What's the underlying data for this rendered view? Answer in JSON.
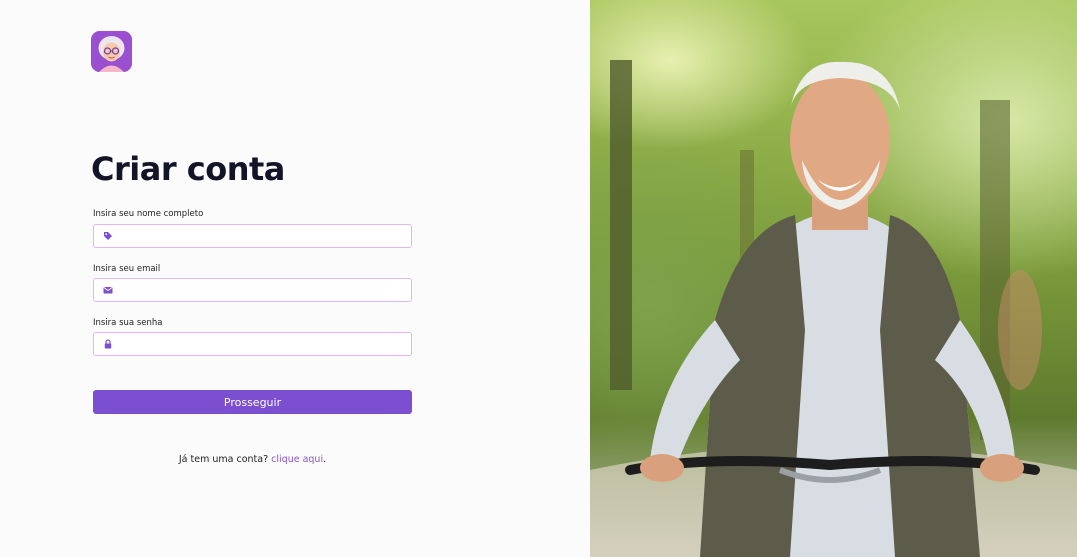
{
  "form": {
    "title": "Criar conta",
    "name_label": "Insira seu nome completo",
    "name_value": "",
    "email_label": "Insira seu email",
    "email_value": "",
    "password_label": "Insira sua senha",
    "password_value": "",
    "submit_label": "Prosseguir",
    "login_prompt": "Já tem uma conta?",
    "login_link": "clique aqui",
    "login_suffix": "."
  },
  "icons": {
    "name_field": "tag-icon",
    "email_field": "envelope-icon",
    "password_field": "lock-icon"
  },
  "colors": {
    "accent": "#7b4fcf",
    "field_border": "#e6b4f0",
    "link": "#8a55c8",
    "icon": "#7b4fcf",
    "title": "#141428"
  }
}
